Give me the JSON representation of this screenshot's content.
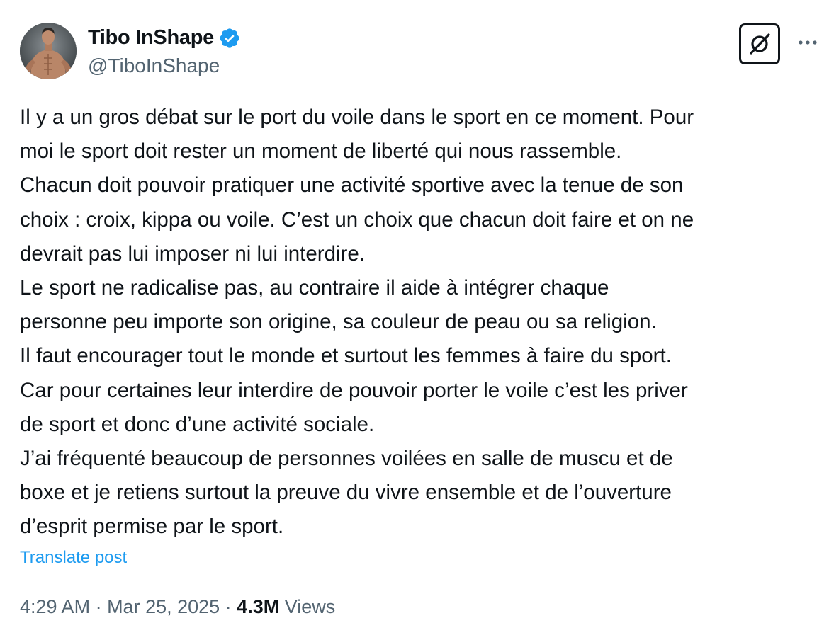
{
  "author": {
    "display_name": "Tibo InShape",
    "handle": "@TiboInShape",
    "verified_badge_color": "#1d9bf0",
    "avatar_icon": "profile-photo"
  },
  "header_actions": {
    "grok_icon": "grok-icon",
    "more_icon": "more-dots-icon"
  },
  "tweet": {
    "lines": [
      "Il y a un gros débat sur le port du voile dans le sport en ce moment. Pour",
      "moi le sport doit rester un moment de liberté qui nous rassemble.",
      "Chacun doit pouvoir pratiquer une activité sportive avec la tenue de son",
      "choix : croix, kippa ou voile. C’est un choix que chacun doit faire et on ne",
      "devrait pas lui imposer ni lui interdire.",
      "Le sport ne radicalise pas, au contraire il aide à intégrer chaque",
      "personne peu importe son origine, sa couleur de peau ou sa religion.",
      "Il faut encourager tout le monde et surtout les femmes à faire du sport.",
      "Car pour certaines leur interdire de pouvoir porter le voile c’est les priver",
      "de sport et donc d’une activité sociale.",
      "J’ai fréquenté beaucoup de personnes voilées en salle de muscu et de",
      "boxe et je retiens surtout la preuve du vivre ensemble et de l’ouverture",
      "d’esprit permise par le sport."
    ],
    "translate_label": "Translate post"
  },
  "meta": {
    "time": "4:29 AM",
    "separator": " · ",
    "date": "Mar 25, 2025",
    "views_count": "4.3M",
    "views_label": " Views"
  }
}
